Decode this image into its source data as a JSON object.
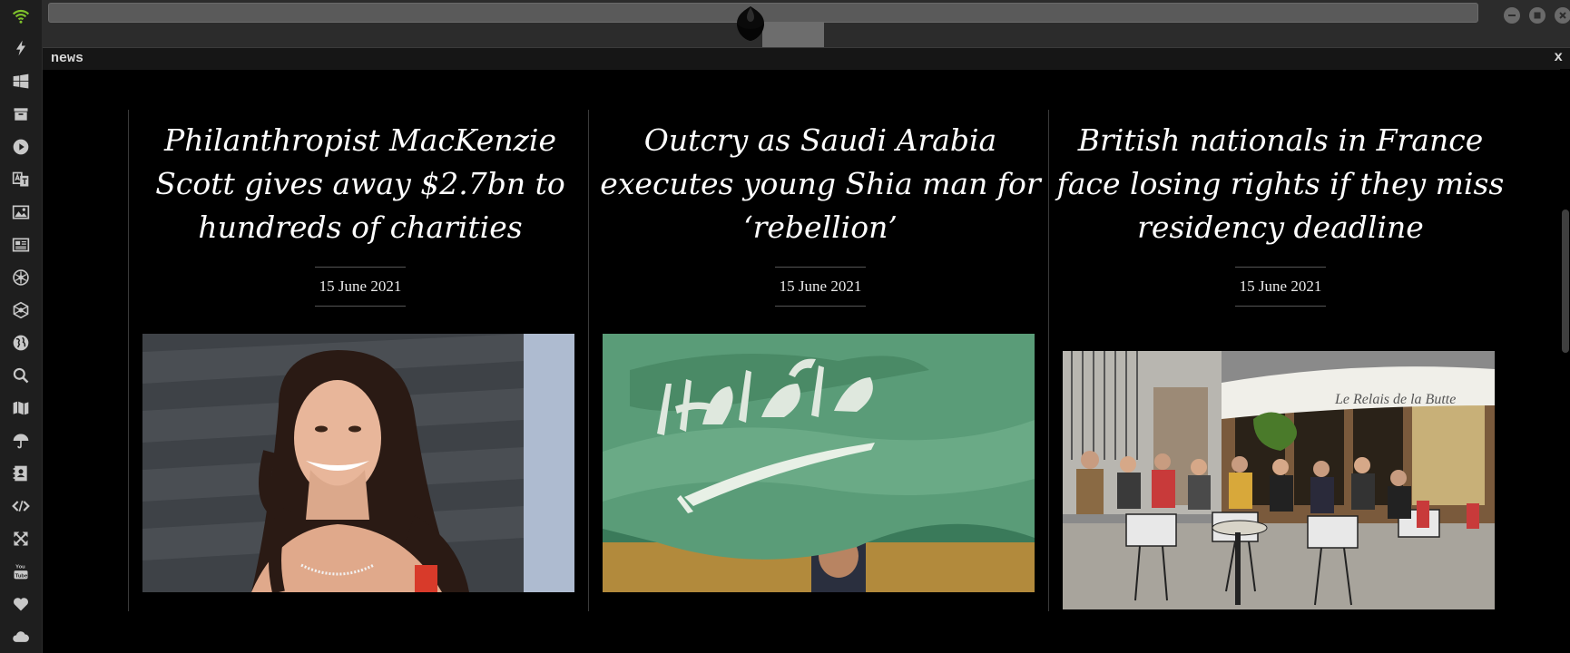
{
  "tab": {
    "title": "news",
    "close_label": "x"
  },
  "colors": {
    "background": "#000000",
    "sidebar": "#1e1e1e",
    "chrome": "#2c2c2c",
    "accent_wifi": "#7ec12b",
    "headline": "#ffffff"
  },
  "sidebar": {
    "icons": [
      "wifi-icon",
      "lightning-icon",
      "windows-icon",
      "archive-icon",
      "play-icon",
      "translate-icon",
      "image-icon",
      "newspaper-icon",
      "rebel-alliance-icon",
      "empire-icon",
      "globe-icon",
      "search-icon",
      "map-icon",
      "umbrella-icon",
      "contact-book-icon",
      "code-icon",
      "expand-icon",
      "youtube-icon",
      "heart-icon",
      "cloud-icon"
    ]
  },
  "window_controls": [
    "minimize-icon",
    "maximize-icon",
    "close-icon"
  ],
  "articles": [
    {
      "headline": "Philanthropist MacKenzie Scott gives away $2.7bn to hundreds of charities",
      "date": "15 June 2021",
      "image": "portrait of smiling woman with long dark hair"
    },
    {
      "headline": "Outcry as Saudi Arabia executes young Shia man for ‘rebellion’",
      "date": "15 June 2021",
      "image": "green Saudi Arabian flag with white script and sword"
    },
    {
      "headline": "British nationals in France face losing rights if they miss residency deadline",
      "date": "15 June 2021",
      "image": "Parisian cafe terrace with people seated at tables"
    }
  ]
}
